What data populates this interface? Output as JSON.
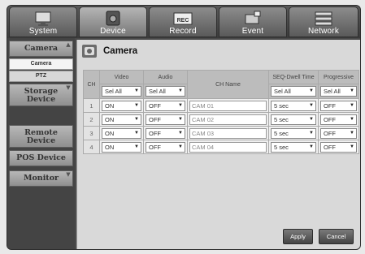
{
  "nav": [
    {
      "label": "System",
      "icon": "monitor-icon"
    },
    {
      "label": "Device",
      "icon": "camera-device-icon"
    },
    {
      "label": "Record",
      "icon": "rec-icon",
      "icon_text": "REC"
    },
    {
      "label": "Event",
      "icon": "event-icon"
    },
    {
      "label": "Network",
      "icon": "network-icon"
    }
  ],
  "active_nav": "Device",
  "sidebar": {
    "camera": "Camera",
    "sub_camera": "Camera",
    "sub_ptz": "PTZ",
    "storage_line1": "Storage",
    "storage_line2": "Device",
    "remote_line1": "Remote",
    "remote_line2": "Device",
    "pos": "POS Device",
    "monitor": "Monitor"
  },
  "page": {
    "title": "Camera"
  },
  "table": {
    "headers": {
      "ch": "CH",
      "video": "Video",
      "audio": "Audio",
      "ch_name": "CH Name",
      "seq": "SEQ-Dwell Time",
      "progressive": "Progressive"
    },
    "select_all": {
      "video": "Sel All",
      "audio": "Sel All",
      "seq": "Sel All",
      "progressive": "Sel All"
    },
    "rows": [
      {
        "ch": "1",
        "video": "ON",
        "audio": "OFF",
        "name": "CAM 01",
        "seq": "5 sec",
        "progressive": "OFF"
      },
      {
        "ch": "2",
        "video": "ON",
        "audio": "OFF",
        "name": "CAM 02",
        "seq": "5 sec",
        "progressive": "OFF"
      },
      {
        "ch": "3",
        "video": "ON",
        "audio": "OFF",
        "name": "CAM 03",
        "seq": "5 sec",
        "progressive": "OFF"
      },
      {
        "ch": "4",
        "video": "ON",
        "audio": "OFF",
        "name": "CAM 04",
        "seq": "5 sec",
        "progressive": "OFF"
      }
    ]
  },
  "buttons": {
    "apply": "Apply",
    "cancel": "Cancel"
  },
  "dropdown_arrow": "▼"
}
